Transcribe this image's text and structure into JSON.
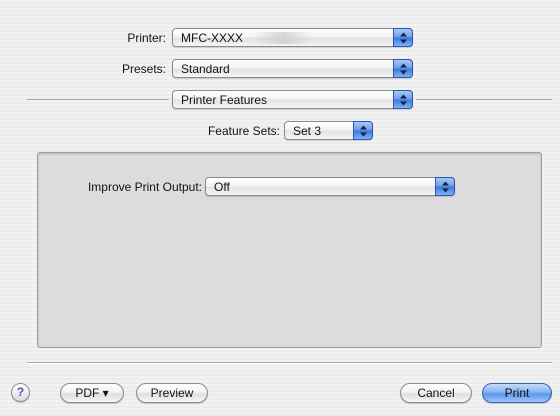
{
  "printer": {
    "label": "Printer:",
    "value": "MFC-XXXX"
  },
  "presets": {
    "label": "Presets:",
    "value": "Standard"
  },
  "pane_selector": {
    "value": "Printer Features"
  },
  "feature_sets": {
    "label": "Feature Sets:",
    "value": "Set 3"
  },
  "improve_output": {
    "label": "Improve Print Output:",
    "value": "Off"
  },
  "footer": {
    "help": "?",
    "pdf_label": "PDF ▾",
    "preview_label": "Preview",
    "cancel_label": "Cancel",
    "print_label": "Print"
  },
  "colors": {
    "accent": "#5a96ea",
    "panel": "#dcdcdc",
    "help_icon": "#6c3fbf"
  }
}
